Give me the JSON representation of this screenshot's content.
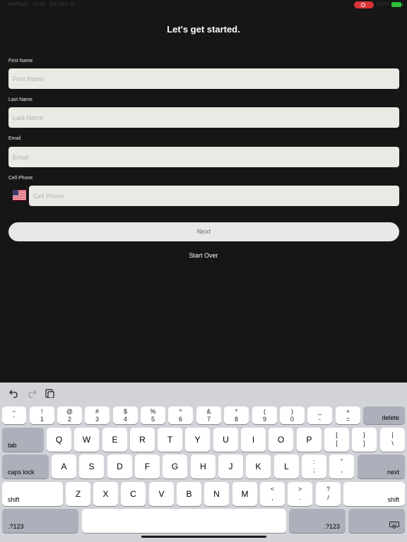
{
  "status_bar": {
    "carrier": "TestFlight",
    "time": "13:58",
    "date": "Sun Nov 10",
    "battery": "100%"
  },
  "page_title": "Let's get started.",
  "form": {
    "first_name": {
      "label": "First Name",
      "placeholder": "First Name",
      "value": ""
    },
    "last_name": {
      "label": "Last Name",
      "placeholder": "Last Name",
      "value": ""
    },
    "email": {
      "label": "Email",
      "placeholder": "Email",
      "value": ""
    },
    "cell_phone": {
      "label": "Cell Phone",
      "placeholder": "Cell Phone",
      "value": "",
      "country_flag": "us-flag-icon"
    }
  },
  "next_label": "Next",
  "start_over_label": "Start Over",
  "keyboard": {
    "toolbar": [
      "undo-icon",
      "redo-icon",
      "paste-icon"
    ],
    "number_row": [
      {
        "top": "~",
        "bottom": "`"
      },
      {
        "top": "!",
        "bottom": "1"
      },
      {
        "top": "@",
        "bottom": "2"
      },
      {
        "top": "#",
        "bottom": "3"
      },
      {
        "top": "$",
        "bottom": "4"
      },
      {
        "top": "%",
        "bottom": "5"
      },
      {
        "top": "^",
        "bottom": "6"
      },
      {
        "top": "&",
        "bottom": "7"
      },
      {
        "top": "*",
        "bottom": "8"
      },
      {
        "top": "(",
        "bottom": "9"
      },
      {
        "top": ")",
        "bottom": "0"
      },
      {
        "top": "_",
        "bottom": "-"
      },
      {
        "top": "+",
        "bottom": "="
      }
    ],
    "delete": "delete",
    "tab": "tab",
    "row_q": [
      "Q",
      "W",
      "E",
      "R",
      "T",
      "Y",
      "U",
      "I",
      "O",
      "P"
    ],
    "row_q_extra": [
      {
        "top": "{",
        "bottom": "["
      },
      {
        "top": "}",
        "bottom": "]"
      },
      {
        "top": "|",
        "bottom": "\\"
      }
    ],
    "caps_lock": "caps lock",
    "row_a": [
      "A",
      "S",
      "D",
      "F",
      "G",
      "H",
      "J",
      "K",
      "L"
    ],
    "row_a_extra": [
      {
        "top": ":",
        "bottom": ";"
      },
      {
        "top": "\"",
        "bottom": ","
      }
    ],
    "next": "next",
    "shift": "shift",
    "row_z": [
      "Z",
      "X",
      "C",
      "V",
      "B",
      "N",
      "M"
    ],
    "row_z_extra": [
      {
        "top": "<",
        "bottom": ","
      },
      {
        "top": ">",
        "bottom": "."
      },
      {
        "top": "?",
        "bottom": "/"
      }
    ],
    "numbers_key": ".?123",
    "dismiss_icon": "keyboard-dismiss-icon"
  }
}
